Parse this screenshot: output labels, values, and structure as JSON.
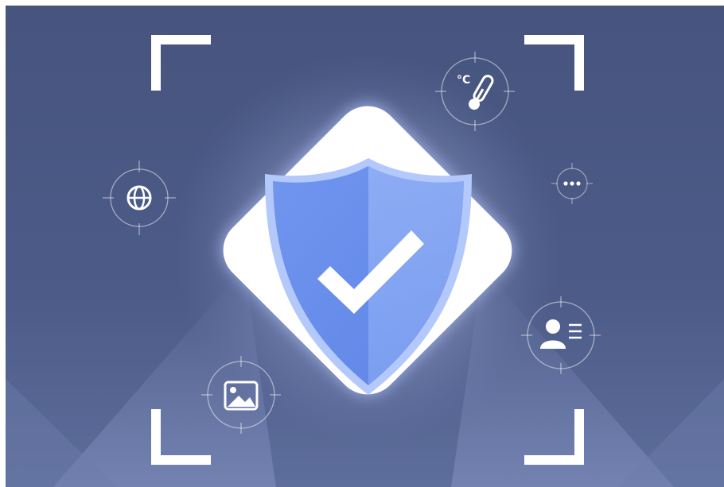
{
  "illustration": {
    "subject": "security-shield-verified",
    "icons": {
      "temperature_label": "°C",
      "temperature": "thermometer-icon",
      "globe": "globe-icon",
      "more": "more-dots-icon",
      "profile": "user-profile-icon",
      "image": "image-icon",
      "shield": "shield-check-icon"
    }
  },
  "colors": {
    "background_top": "#47557f",
    "background_bottom": "#5b6b98",
    "frame_white": "#ffffff",
    "card_white": "#ffffff",
    "shield_dark": "#6f93ee",
    "shield_light": "#9cb9f9",
    "shield_rim": "#b9cefc",
    "check": "#ffffff"
  }
}
